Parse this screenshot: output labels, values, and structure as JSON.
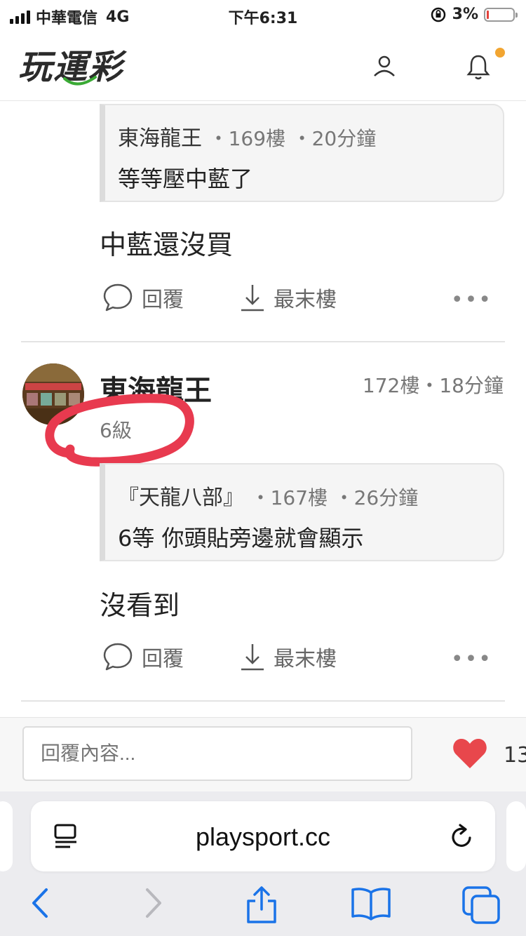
{
  "status_bar": {
    "carrier": "中華電信",
    "network": "4G",
    "time": "下午6:31",
    "battery": "3%"
  },
  "header": {
    "logo": "玩運彩",
    "icons": [
      "user-icon",
      "bell-icon"
    ]
  },
  "post1": {
    "quote": {
      "author": "東海龍王",
      "floor": "169樓",
      "time": "20分鐘",
      "text": "等等壓中藍了"
    },
    "text": "中藍還沒買",
    "actions": {
      "reply": "回覆",
      "last_floor": "最末樓",
      "more": "•••"
    }
  },
  "post2": {
    "author": "東海龍王",
    "floor": "172樓",
    "time": "18分鐘",
    "level": "6級",
    "quote": {
      "author": "『天龍八部』",
      "floor": "167樓",
      "time": "26分鐘",
      "text": "6等 你頭貼旁邊就會顯示"
    },
    "text": "沒看到",
    "actions": {
      "reply": "回覆",
      "last_floor": "最末樓",
      "more": "•••"
    }
  },
  "reply_bar": {
    "placeholder": "回覆內容...",
    "like_count": "13"
  },
  "browser": {
    "url": "playsport.cc",
    "accent_color": "#1a73e8"
  },
  "colors": {
    "annotation_red": "#e83a4f",
    "like_red": "#e8474c",
    "notif_dot": "#f2a531"
  }
}
